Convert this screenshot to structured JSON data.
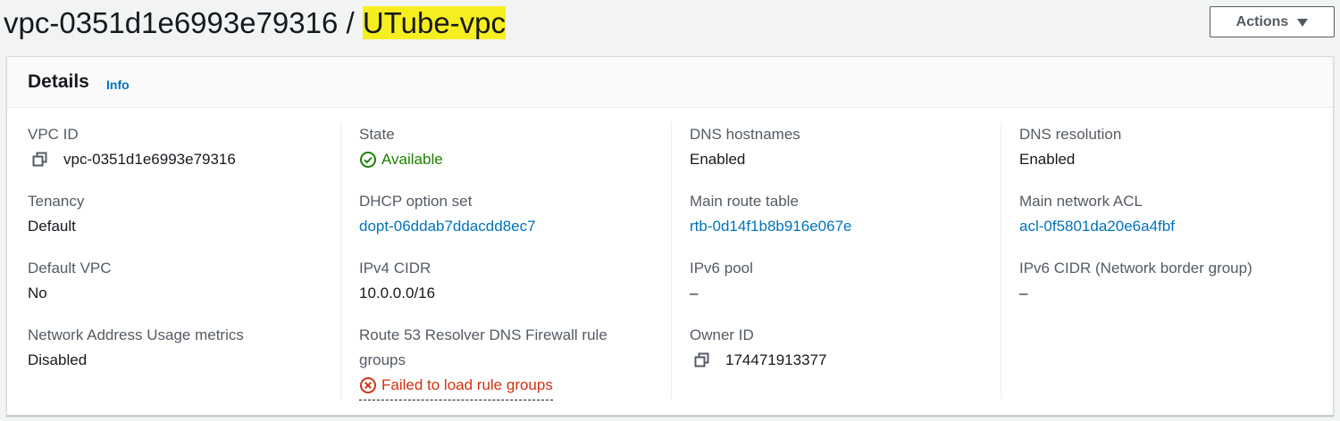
{
  "header": {
    "title_prefix": "vpc-0351d1e6993e79316 / ",
    "title_name": "UTube-vpc",
    "actions_label": "Actions"
  },
  "details": {
    "title": "Details",
    "info_label": "Info",
    "vpc_id": {
      "label": "VPC ID",
      "value": "vpc-0351d1e6993e79316"
    },
    "tenancy": {
      "label": "Tenancy",
      "value": "Default"
    },
    "default_vpc": {
      "label": "Default VPC",
      "value": "No"
    },
    "network_address_usage": {
      "label": "Network Address Usage metrics",
      "value": "Disabled"
    },
    "state": {
      "label": "State",
      "value": "Available"
    },
    "dhcp_option_set": {
      "label": "DHCP option set",
      "value": "dopt-06ddab7ddacdd8ec7"
    },
    "ipv4_cidr": {
      "label": "IPv4 CIDR",
      "value": "10.0.0.0/16"
    },
    "route53": {
      "label_line1": "Route 53 Resolver DNS Firewall rule",
      "label_line2": "groups",
      "value": "Failed to load rule groups"
    },
    "dns_hostnames": {
      "label": "DNS hostnames",
      "value": "Enabled"
    },
    "main_route_table": {
      "label": "Main route table",
      "value": "rtb-0d14f1b8b916e067e"
    },
    "ipv6_pool": {
      "label": "IPv6 pool",
      "value": "–"
    },
    "owner_id": {
      "label": "Owner ID",
      "value": "174471913377"
    },
    "dns_resolution": {
      "label": "DNS resolution",
      "value": "Enabled"
    },
    "main_network_acl": {
      "label": "Main network ACL",
      "value": "acl-0f5801da20e6a4fbf"
    },
    "ipv6_cidr": {
      "label": "IPv6 CIDR (Network border group)",
      "value": "–"
    }
  },
  "icons": {
    "copy": "copy-icon",
    "status_ok": "check-circle-icon",
    "status_error": "x-circle-icon",
    "actions_caret": "caret-down-icon"
  },
  "colors": {
    "link": "#0073bb",
    "success": "#1d8102",
    "error": "#d13212",
    "highlight": "#f7ee1f"
  }
}
